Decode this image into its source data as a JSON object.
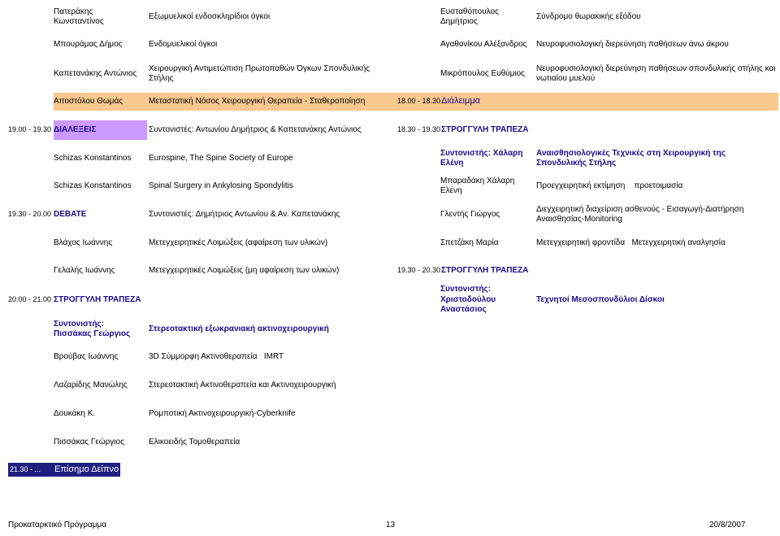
{
  "colors": {
    "peach": "#f8c88f",
    "lilac": "#cc99ff",
    "navy": "#1f1f80",
    "white": "#ffffff"
  },
  "top_rows": [
    {
      "left_name": "Πατεράκης Κωνσταντίνος",
      "left_topic": "Εξωμυελικοί ενδοσκληρίδιοι όγκοι",
      "right_name": "Ευσταθόπουλος Δημήτριος",
      "right_topic": "Σύνδρομο θωρακικής εξόδου"
    },
    {
      "left_name": "Μπουράμας Δήμος",
      "left_topic": "Ενδομυελικοί όγκοι",
      "right_name": "Αγαθονίκου Αλέξανδρος",
      "right_topic": "Νευροφυσιολογική διερεύνηση παθήσεων άνω άκρου"
    },
    {
      "left_name": "Καπετανάκης Αντώνιος",
      "left_topic": "Χειρουργική Αντιμετώπιση Πρωτοπαθών Όγκων Σπονδυλικής Στήλης",
      "right_name": "Μικρόπουλος Ευθύμιος",
      "right_topic": "Νευροφυσιολογική διερεύνηση παθήσεων σπονδυλικής στήλης και νωτιαίου μυελού"
    }
  ],
  "row4": {
    "left_name": "Αποστόλου Θωμάς",
    "left_topic": "Μεταστατική Νόσος Χειρουργική Θεραπεία - Σταθεροποίηση",
    "right_time": "18.00 - 18.30",
    "right_label": "Διάλειμμα"
  },
  "row5": {
    "left_time": "19.00 - 19.30",
    "left_label": "ΔΙΑΛΕΞΕΙΣ",
    "left_topic": "Συντονιστές: Αντωνίου Δημήτριος & Καπετανάκης Αντώνιος",
    "right_time": "18.30 - 19.30",
    "right_label": "ΣΤΡΟΓΓΥΛΗ ΤΡΑΠΕΖΑ"
  },
  "row6": {
    "left_name": "Schizas Konstantinos",
    "left_topic": "Eurospine, The Spine Society of Europe",
    "right_name": "Συντονιστής: Χάλαρη Ελένη",
    "right_topic": "Αναισθησιολογικές Τεχνικές στη Χειρουργική της Σπονδυλικής Στήλης"
  },
  "row7": {
    "left_name": "Schizas Konstantinos",
    "left_topic": "Spinal Surgery in Ankylosing Spondylitis",
    "right_name": "Μπαραδάκη Χάλαρη Ελένη",
    "right_topic": "Προεγχειρητική εκτίμηση    προετοιμασία"
  },
  "row8": {
    "left_time": "19.30 - 20.00",
    "left_label": "DEBATE",
    "left_topic": "Συντονιστές: Δημήτριος Αντωνίου & Αν. Καπετανάκης",
    "right_name": "Γλεντής Γιώργος",
    "right_topic": "Διεγχειρητική διαχείριση ασθενούς - Εισαγωγή-Διατήρηση Αναισθησίας-Monitoring"
  },
  "row9": {
    "left_name": "Βλάχος Ιωάννης",
    "left_topic": "Μετεγχειρητικές Λοιμώξεις (αφαίρεση των υλικών)",
    "right_name": "Σπετζάκη Μαρία",
    "right_topic": "Μετεγχειρητική φροντίδα   Μετεγχειρητική αναλγησία"
  },
  "row10": {
    "left_name": "Γελαλής Ιωάννης",
    "left_topic": "Μετεγχειρητικές Λοιμώξεις (μη αφαίρεση των υλικών)",
    "right_time": "19.30 - 20.30",
    "right_label": "ΣΤΡΟΓΓΥΛΗ ΤΡΑΠΕΖΑ"
  },
  "row11": {
    "left_time": "20.00 - 21.00",
    "left_label": "ΣΤΡΟΓΓΥΛΗ ΤΡΑΠΕΖΑ",
    "right_name": "Συντονιστής: Χριστοδούλου Αναστάσιος",
    "right_topic": "Τεχνητοί Μεσοσπονδύλιοι Δίσκοι"
  },
  "row12": {
    "left_name": "Συντονιστής: Πισσάκας Γεώργιος",
    "left_topic": "Στερεοτακτική εξωκρανιακή ακτινοχειρουργική"
  },
  "bottom_rows": [
    {
      "name": "Βρούβας Ιωάννης",
      "topic": "3D Σύμμορφη Ακτινοθεραπεία   IMRT"
    },
    {
      "name": "Λαζαρίδης Μανώλης",
      "topic": "Στερεοτακτική Ακτινοθεραπεία και Ακτινοχειρουργική"
    },
    {
      "name": "Δουκάκη Κ.",
      "topic": "Ρομποτική Ακτινοχειρουργική-Cyberknife"
    },
    {
      "name": "Πισσάκας Γεώργιος",
      "topic": "Ελικοειδής Τομοθεραπεία"
    }
  ],
  "dinner": {
    "time": "21.30 - ...",
    "label": "Επίσημο Δείπνο"
  },
  "footer": {
    "left": "Προκαταρκτικό Πρόγραμμα",
    "page": "13",
    "date": "20/8/2007"
  }
}
